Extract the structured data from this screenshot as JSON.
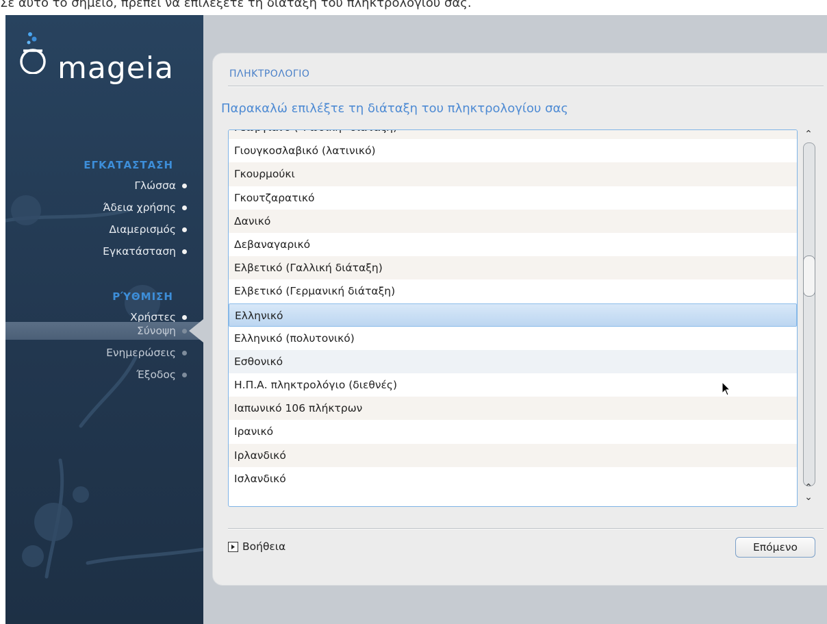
{
  "top_caption": "Σε αυτό το σημείο, πρέπει να επιλέξετε τη διάταξη του πληκτρολογίου σας.",
  "brand": {
    "logo_text": "mageia"
  },
  "sidebar": {
    "sections": [
      {
        "title": "ΕΓΚΑΤΑΣΤΑΣΗ",
        "items": [
          {
            "label": "Γλώσσα",
            "state": "done"
          },
          {
            "label": "Άδεια χρήσης",
            "state": "done"
          },
          {
            "label": "Διαμερισμός",
            "state": "done"
          },
          {
            "label": "Εγκατάσταση",
            "state": "done"
          }
        ]
      },
      {
        "title": "ΡΎΘΜΙΣΗ",
        "items": [
          {
            "label": "Χρήστες",
            "state": "done"
          },
          {
            "label": "Σύνοψη",
            "state": "active"
          },
          {
            "label": "Ενημερώσεις",
            "state": "pending"
          },
          {
            "label": "Έξοδος",
            "state": "pending"
          }
        ]
      }
    ]
  },
  "panel": {
    "title": "ΠΛΗΚΤΡΟΛΟΓΙΟ",
    "prompt": "Παρακαλώ επιλέξτε τη διάταξη του πληκτρολογίου σας",
    "list": {
      "items": [
        "Γεωργιανό (\"Ρωσική\" διάταξη)",
        "Γιουγκοσλαβικό (λατινικό)",
        "Γκουρμούκι",
        "Γκουτζαρατικό",
        "Δανικό",
        "Δεβαναγαρικό",
        "Ελβετικό (Γαλλική διάταξη)",
        "Ελβετικό (Γερμανική διάταξη)",
        "Ελληνικό",
        "Ελληνικό (πολυτονικό)",
        "Εσθονικό",
        "Η.Π.Α. πληκτρολόγιο (διεθνές)",
        "Ιαπωνικό 106 πλήκτρων",
        "Ιρανικό",
        "Ιρλανδικό",
        "Ισλανδικό"
      ],
      "selected": "Ελληνικό",
      "hovered": "Εσθονικό"
    },
    "help_label": "Βοήθεια",
    "next_label": "Επόμενο"
  },
  "colors": {
    "sidebar_bg": "#22374f",
    "section_title": "#3d8ed9",
    "panel_title": "#4a80c8",
    "selection": "#bcd6f1"
  }
}
